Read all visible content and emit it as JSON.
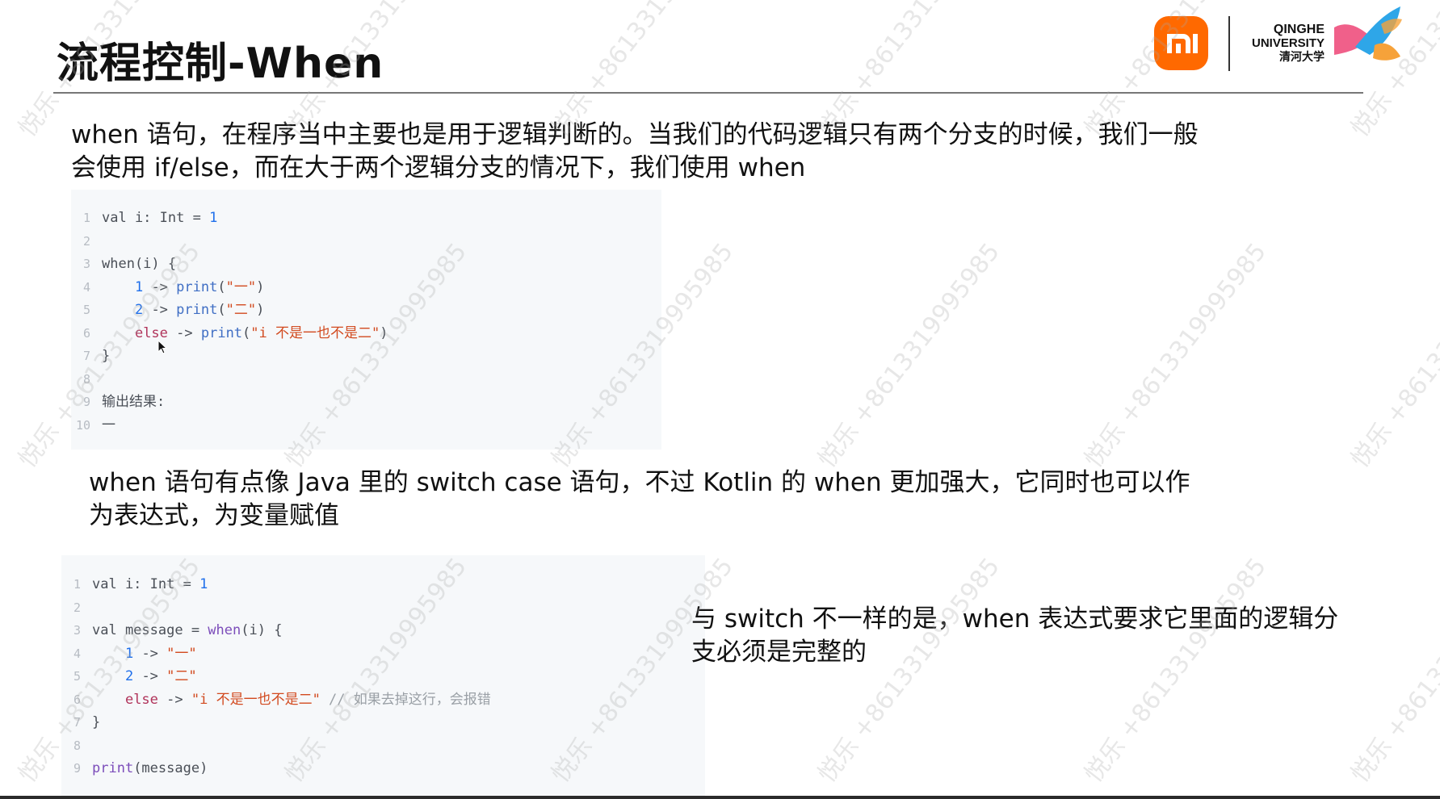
{
  "slide": {
    "title": "流程控制-When",
    "logos": {
      "mi_logo_text": "mi",
      "university_line1": "QINGHE",
      "university_line2": "UNIVERSITY",
      "university_line3": "清河大学",
      "colors": {
        "mi_orange": "#ff6900",
        "ribbon_pink": "#f0608a",
        "ribbon_blue": "#2ea6e8",
        "ribbon_orange": "#f6a23a"
      }
    },
    "intro": {
      "line1": "when 语句，在程序当中主要也是用于逻辑判断的。当我们的代码逻辑只有两个分支的时候，我们一般",
      "line2": "会使用 if/else，而在大于两个逻辑分支的情况下，我们使用 when"
    },
    "code1": {
      "lines": [
        {
          "n": "1",
          "tokens": [
            {
              "t": "val i: Int = ",
              "c": "default"
            },
            {
              "t": "1",
              "c": "num"
            }
          ]
        },
        {
          "n": "2",
          "tokens": []
        },
        {
          "n": "3",
          "tokens": [
            {
              "t": "when(i) {",
              "c": "default"
            }
          ]
        },
        {
          "n": "4",
          "tokens": [
            {
              "t": "    ",
              "c": "default"
            },
            {
              "t": "1",
              "c": "num"
            },
            {
              "t": " -> ",
              "c": "default"
            },
            {
              "t": "print",
              "c": "fn"
            },
            {
              "t": "(",
              "c": "default"
            },
            {
              "t": "\"一\"",
              "c": "str"
            },
            {
              "t": ")",
              "c": "default"
            }
          ]
        },
        {
          "n": "5",
          "tokens": [
            {
              "t": "    ",
              "c": "default"
            },
            {
              "t": "2",
              "c": "num"
            },
            {
              "t": " -> ",
              "c": "default"
            },
            {
              "t": "print",
              "c": "fn"
            },
            {
              "t": "(",
              "c": "default"
            },
            {
              "t": "\"二\"",
              "c": "str"
            },
            {
              "t": ")",
              "c": "default"
            }
          ]
        },
        {
          "n": "6",
          "tokens": [
            {
              "t": "    ",
              "c": "default"
            },
            {
              "t": "else",
              "c": "kw"
            },
            {
              "t": " -> ",
              "c": "default"
            },
            {
              "t": "print",
              "c": "fn"
            },
            {
              "t": "(",
              "c": "default"
            },
            {
              "t": "\"i 不是一也不是二\"",
              "c": "str"
            },
            {
              "t": ")",
              "c": "default"
            }
          ]
        },
        {
          "n": "7",
          "tokens": [
            {
              "t": "}",
              "c": "default"
            }
          ]
        },
        {
          "n": "8",
          "tokens": []
        },
        {
          "n": "9",
          "tokens": [
            {
              "t": "输出结果:",
              "c": "default"
            }
          ]
        },
        {
          "n": "10",
          "tokens": [
            {
              "t": "一",
              "c": "default"
            }
          ]
        }
      ]
    },
    "mid": {
      "line1": "when 语句有点像 Java 里的 switch case 语句，不过 Kotlin 的 when 更加强大，它同时也可以作",
      "line2": "为表达式，为变量赋值"
    },
    "code2": {
      "lines": [
        {
          "n": "1",
          "tokens": [
            {
              "t": "val i: Int = ",
              "c": "default"
            },
            {
              "t": "1",
              "c": "num"
            }
          ]
        },
        {
          "n": "2",
          "tokens": []
        },
        {
          "n": "3",
          "tokens": [
            {
              "t": "val message = ",
              "c": "default"
            },
            {
              "t": "when",
              "c": "call"
            },
            {
              "t": "(i) {",
              "c": "default"
            }
          ]
        },
        {
          "n": "4",
          "tokens": [
            {
              "t": "    ",
              "c": "default"
            },
            {
              "t": "1",
              "c": "num"
            },
            {
              "t": " -> ",
              "c": "default"
            },
            {
              "t": "\"一\"",
              "c": "str"
            }
          ]
        },
        {
          "n": "5",
          "tokens": [
            {
              "t": "    ",
              "c": "default"
            },
            {
              "t": "2",
              "c": "num"
            },
            {
              "t": " -> ",
              "c": "default"
            },
            {
              "t": "\"二\"",
              "c": "str"
            }
          ]
        },
        {
          "n": "6",
          "tokens": [
            {
              "t": "    ",
              "c": "default"
            },
            {
              "t": "else",
              "c": "kw"
            },
            {
              "t": " -> ",
              "c": "default"
            },
            {
              "t": "\"i 不是一也不是二\"",
              "c": "str"
            },
            {
              "t": " // 如果去掉这行，会报错",
              "c": "cmt"
            }
          ]
        },
        {
          "n": "7",
          "tokens": [
            {
              "t": "}",
              "c": "default"
            }
          ]
        },
        {
          "n": "8",
          "tokens": []
        },
        {
          "n": "9",
          "tokens": [
            {
              "t": "print",
              "c": "call"
            },
            {
              "t": "(message)",
              "c": "default"
            }
          ]
        }
      ]
    },
    "side_note": {
      "line1": "与 switch 不一样的是，when 表达式要求它里面的逻辑分",
      "line2": "支必须是完整的"
    },
    "watermark": "悦乐 +8613319995985"
  }
}
